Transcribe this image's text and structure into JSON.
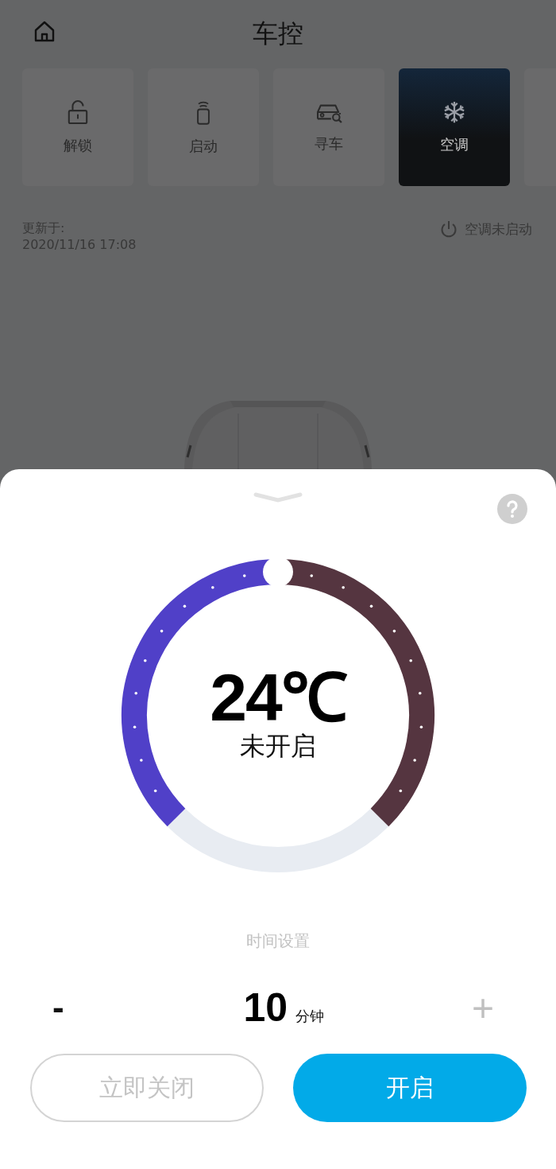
{
  "header": {
    "title": "车控"
  },
  "tiles": [
    {
      "kind": "unlock",
      "label": "解锁",
      "selected": false
    },
    {
      "kind": "start",
      "label": "启动",
      "selected": false
    },
    {
      "kind": "find",
      "label": "寻车",
      "selected": false
    },
    {
      "kind": "climate",
      "label": "空调",
      "selected": true
    }
  ],
  "status": {
    "updated_label": "更新于:",
    "updated_time": "2020/11/16 17:08",
    "ac_status": "空调未启动"
  },
  "sheet": {
    "dial": {
      "temperature": "24℃",
      "state": "未开启"
    },
    "timer": {
      "title": "时间设置",
      "minus": "-",
      "value": "10",
      "unit": "分钟",
      "plus": "+"
    },
    "buttons": [
      {
        "kind": "secondary",
        "label": "立即关闭"
      },
      {
        "kind": "primary",
        "label": "开启"
      }
    ]
  }
}
